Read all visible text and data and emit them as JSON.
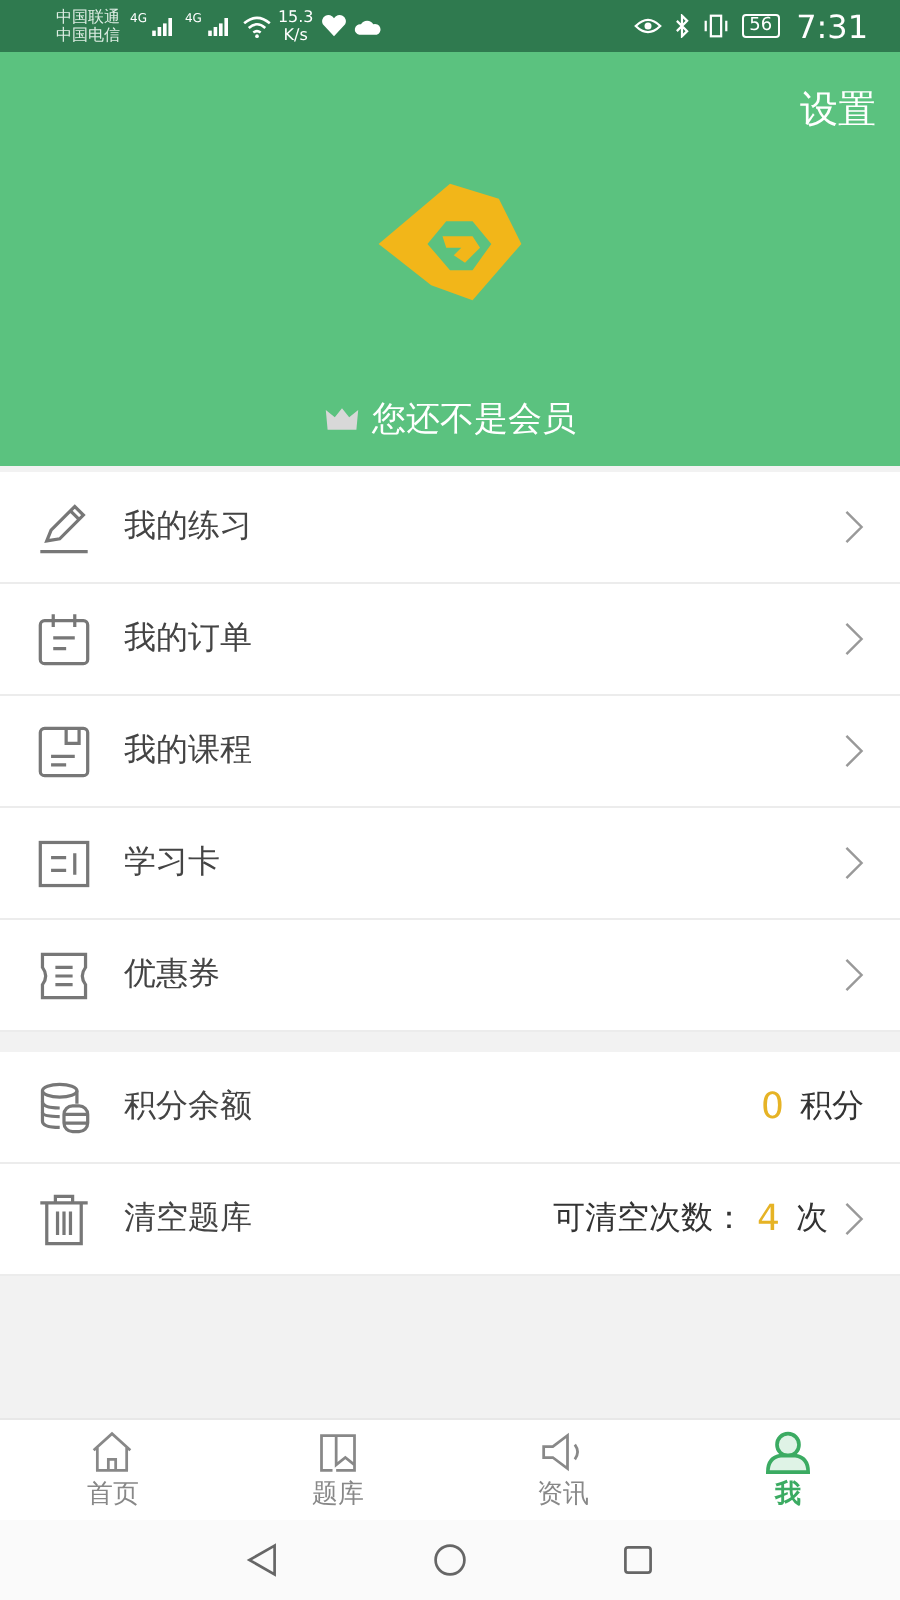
{
  "status_bar": {
    "carrier_1": "中国联通",
    "carrier_2": "中国电信",
    "network_1": "4G",
    "network_2": "4G",
    "speed": "15.3",
    "speed_unit": "K/s",
    "battery": "56",
    "time": "7:31"
  },
  "header": {
    "settings": "设置",
    "membership": "您还不是会员"
  },
  "menu": [
    {
      "label": "我的练习"
    },
    {
      "label": "我的订单"
    },
    {
      "label": "我的课程"
    },
    {
      "label": "学习卡"
    },
    {
      "label": "优惠券"
    }
  ],
  "account": [
    {
      "kind": "balance",
      "label": "积分余额",
      "value": "0",
      "unit": "积分"
    },
    {
      "kind": "clear",
      "label": "清空题库",
      "prefix": "可清空次数：",
      "value": "4",
      "unit": "次"
    }
  ],
  "tabs": [
    {
      "label": "首页",
      "selected": false
    },
    {
      "label": "题库",
      "selected": false
    },
    {
      "label": "资讯",
      "selected": false
    },
    {
      "label": "我",
      "selected": true
    }
  ]
}
